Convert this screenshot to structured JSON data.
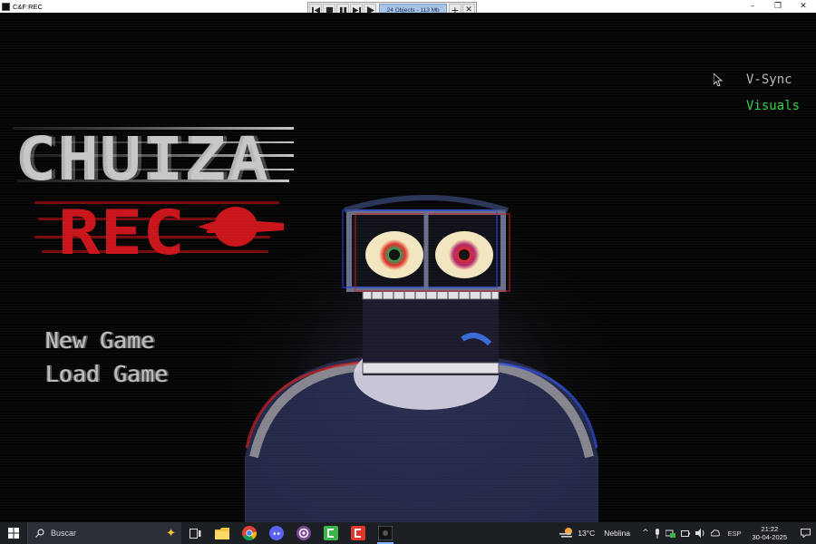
{
  "window": {
    "title": "C&F:REC",
    "minimize_glyph": "–",
    "maximize_glyph": "❐",
    "close_glyph": "✕"
  },
  "debug_toolbar": {
    "status": "24 Objects - 113 Mb",
    "plus_glyph": "+",
    "close_glyph": "✕"
  },
  "game": {
    "logo": {
      "line1": "CHUIZA",
      "line2": "REC"
    },
    "menu": {
      "new_game": "New Game",
      "load_game": "Load Game"
    },
    "options": {
      "vsync": "V-Sync",
      "visuals": "Visuals"
    },
    "colors": {
      "visuals_active": "#2fd14a",
      "logo_red": "#c8141a",
      "logo_gray": "#b4b4b4"
    }
  },
  "taskbar": {
    "search_placeholder": "Buscar",
    "apps": [
      "task-view",
      "file-explorer",
      "chrome",
      "discord",
      "tor-browser",
      "clickteam-fusion-green",
      "clickteam-fusion-red",
      "game-window"
    ],
    "weather": {
      "temp": "13°C",
      "condition": "Neblina"
    },
    "language": "ESP",
    "time": "21:22",
    "date": "30-04-2025",
    "tray_chevron": "^"
  }
}
